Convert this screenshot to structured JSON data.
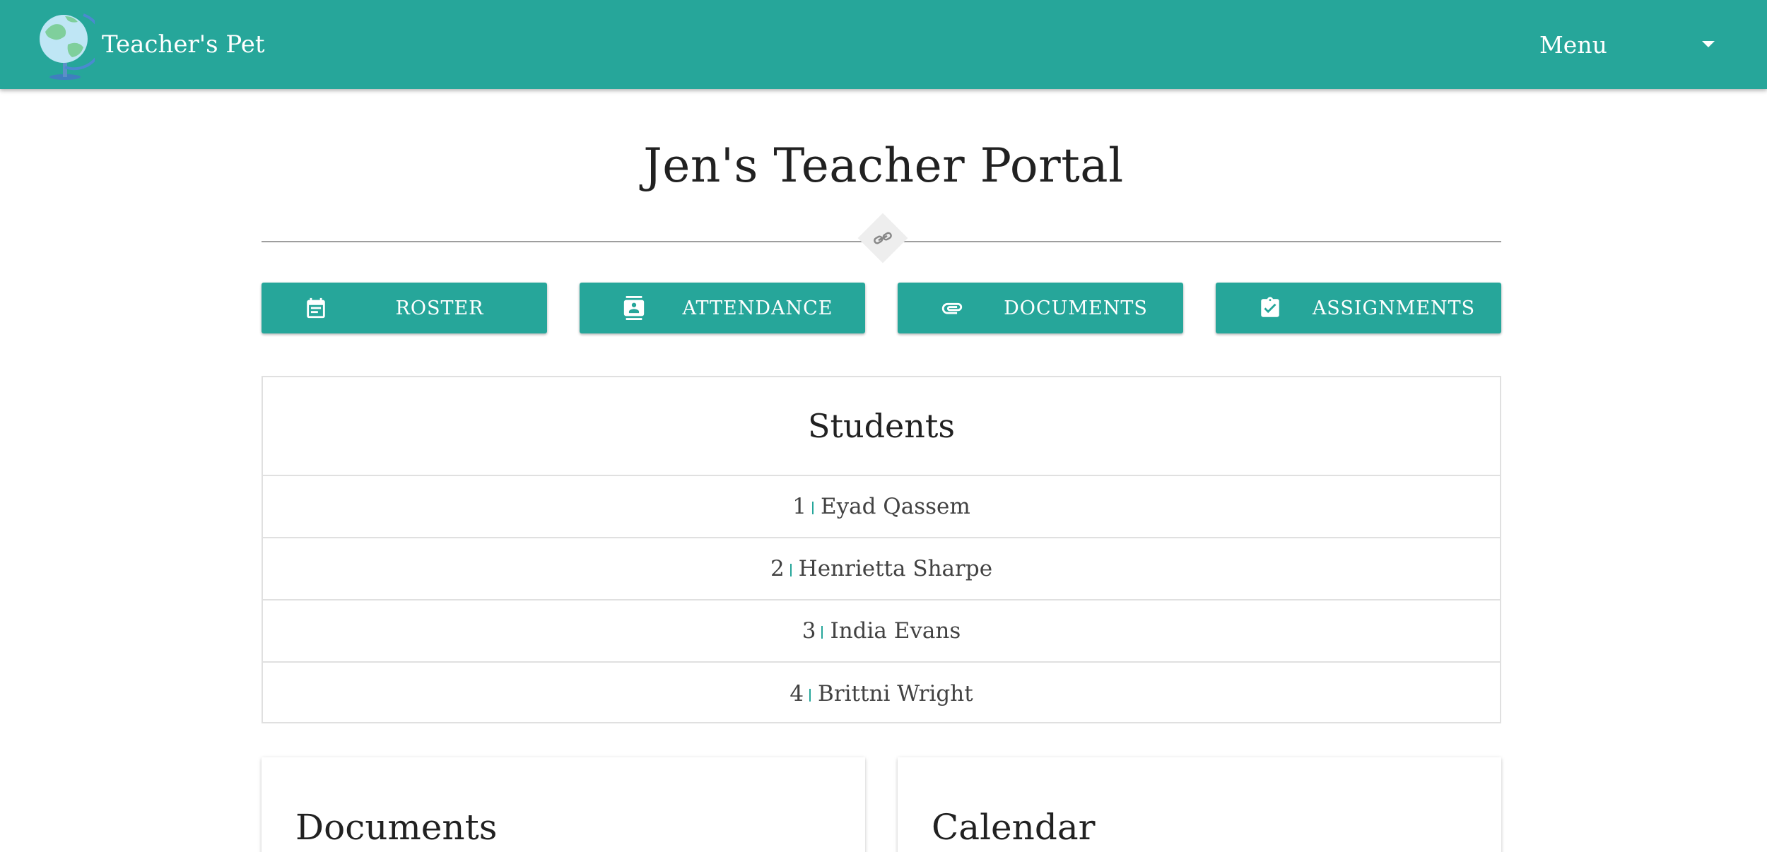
{
  "app": {
    "name": "Teacher's Pet"
  },
  "nav": {
    "menu_label": "Menu"
  },
  "page": {
    "title": "Jen's Teacher Portal"
  },
  "buttons": [
    {
      "label": "ROSTER",
      "icon": "calendar-note-icon"
    },
    {
      "label": "ATTENDANCE",
      "icon": "contact-card-icon"
    },
    {
      "label": "DOCUMENTS",
      "icon": "paperclip-icon"
    },
    {
      "label": "ASSIGNMENTS",
      "icon": "clipboard-check-icon"
    }
  ],
  "students": {
    "heading": "Students",
    "rows": [
      {
        "num": "1",
        "name": "Eyad Qassem"
      },
      {
        "num": "2",
        "name": "Henrietta Sharpe"
      },
      {
        "num": "3",
        "name": "India Evans"
      },
      {
        "num": "4",
        "name": "Brittni Wright"
      }
    ]
  },
  "cards": {
    "documents_title": "Documents",
    "calendar_title": "Calendar"
  },
  "colors": {
    "primary": "#26a69a",
    "divider": "#9e9e9e",
    "border": "#e0e0e0"
  }
}
